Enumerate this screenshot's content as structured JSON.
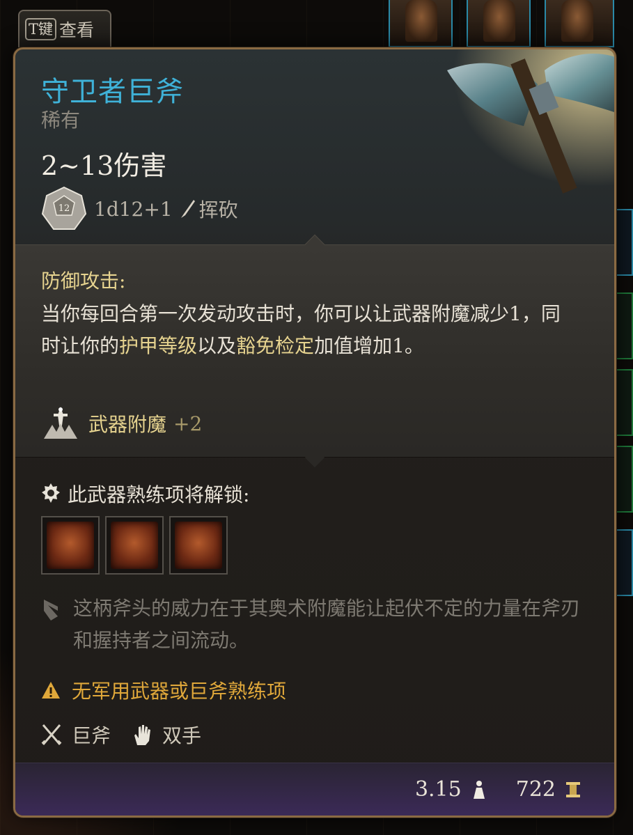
{
  "top_key": {
    "key": "T键",
    "label": "查看"
  },
  "item": {
    "name": "守卫者巨斧",
    "rarity": "稀有",
    "damage": "2~13伤害",
    "dice": "1d12+1",
    "damage_type": "挥砍",
    "die_face": "12"
  },
  "passive": {
    "title": "防御攻击:",
    "desc_1": "当你每回合第一次发动攻击时，你可以让武器附魔减少1，同时让你的",
    "hl_1": "护甲等级",
    "desc_2": "以及",
    "hl_2": "豁免检定",
    "desc_3": "加值增加1。"
  },
  "enchant": {
    "label": "武器附魔",
    "value": "+2"
  },
  "proficiency": {
    "heading": "此武器熟练项将解锁:",
    "actions": [
      "action-1",
      "action-2",
      "action-3"
    ]
  },
  "flavor": "这柄斧头的威力在于其奥术附魔能让起伏不定的力量在斧刃和握持者之间流动。",
  "warning": "无军用武器或巨斧熟练项",
  "tags": {
    "weapon_type": "巨斧",
    "handedness": "双手"
  },
  "footer": {
    "weight": "3.15",
    "value": "722"
  },
  "colors": {
    "title": "#3fb2d8",
    "highlight": "#e6d38f",
    "warning": "#e0a83a",
    "border": "#8a6a43"
  }
}
